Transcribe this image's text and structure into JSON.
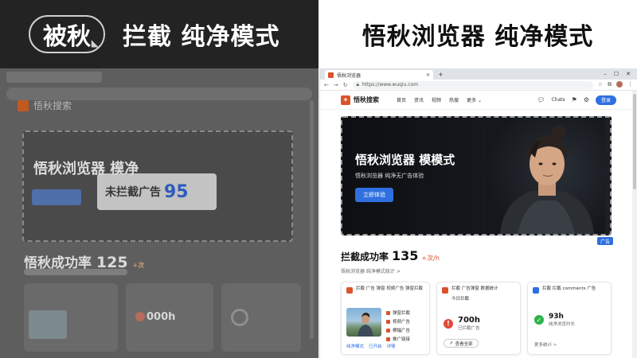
{
  "headline_left": {
    "brand_logo_text": "被秋",
    "text": "拦截 纯净模式"
  },
  "headline_right": {
    "text": "悟秋浏览器 纯净模式"
  },
  "left_overlay": {
    "brand": "悟秋搜索",
    "hero_title": "悟秋浏览器 模净",
    "label_text": "未拦截广告",
    "label_num": "95",
    "rate_label": "悟秋成功率",
    "rate_num": "125",
    "rate_unit": "+次",
    "card_num": "000h"
  },
  "browser": {
    "tab_title": "悟秋浏览器",
    "url": "https://www.wuqiu.com",
    "window_controls": [
      "–",
      "☐",
      "✕"
    ]
  },
  "site": {
    "brand_name": "悟秋搜索",
    "nav_links": [
      "首页",
      "资讯",
      "视频",
      "热搜",
      "更多 ⌄"
    ],
    "nav_more_label": "Chats",
    "login_label": "登录"
  },
  "hero": {
    "title": "悟秋浏览器 模模式",
    "subtitle": "悟秋浏览器 纯净无广告体验",
    "button_label": "立即体验"
  },
  "ad_badge": "广告",
  "stats": {
    "rate_label": "拦截成功率",
    "rate_value": "135",
    "rate_unit": "+次/h",
    "rate_sub": "悟秋浏览器 纯净模式统计 >"
  },
  "cards": {
    "c1": {
      "title": "拦截 广告 弹窗 视频广告 弹窗拦截",
      "lines": [
        "弹窗拦截",
        "视频广告",
        "横幅广告",
        "推广链接"
      ],
      "footer": [
        "纯净模式",
        "已开启",
        "详情"
      ]
    },
    "c2": {
      "title": "拦截 广告弹窗 数据统计",
      "subtitle": "今日拦截",
      "stat_value": "700h",
      "stat_label": "已拦截广告",
      "button_label": "查看全部"
    },
    "c3": {
      "title": "拦截 拦截 comments 广告",
      "stat_value": "93h",
      "stat_label": "纯净浏览时长",
      "footer": "更多统计 >"
    }
  },
  "colors": {
    "accent_blue": "#2f6fe0",
    "brand_orange": "#d9542b",
    "warn_red": "#e04a3a",
    "ok_green": "#2cb34a"
  }
}
